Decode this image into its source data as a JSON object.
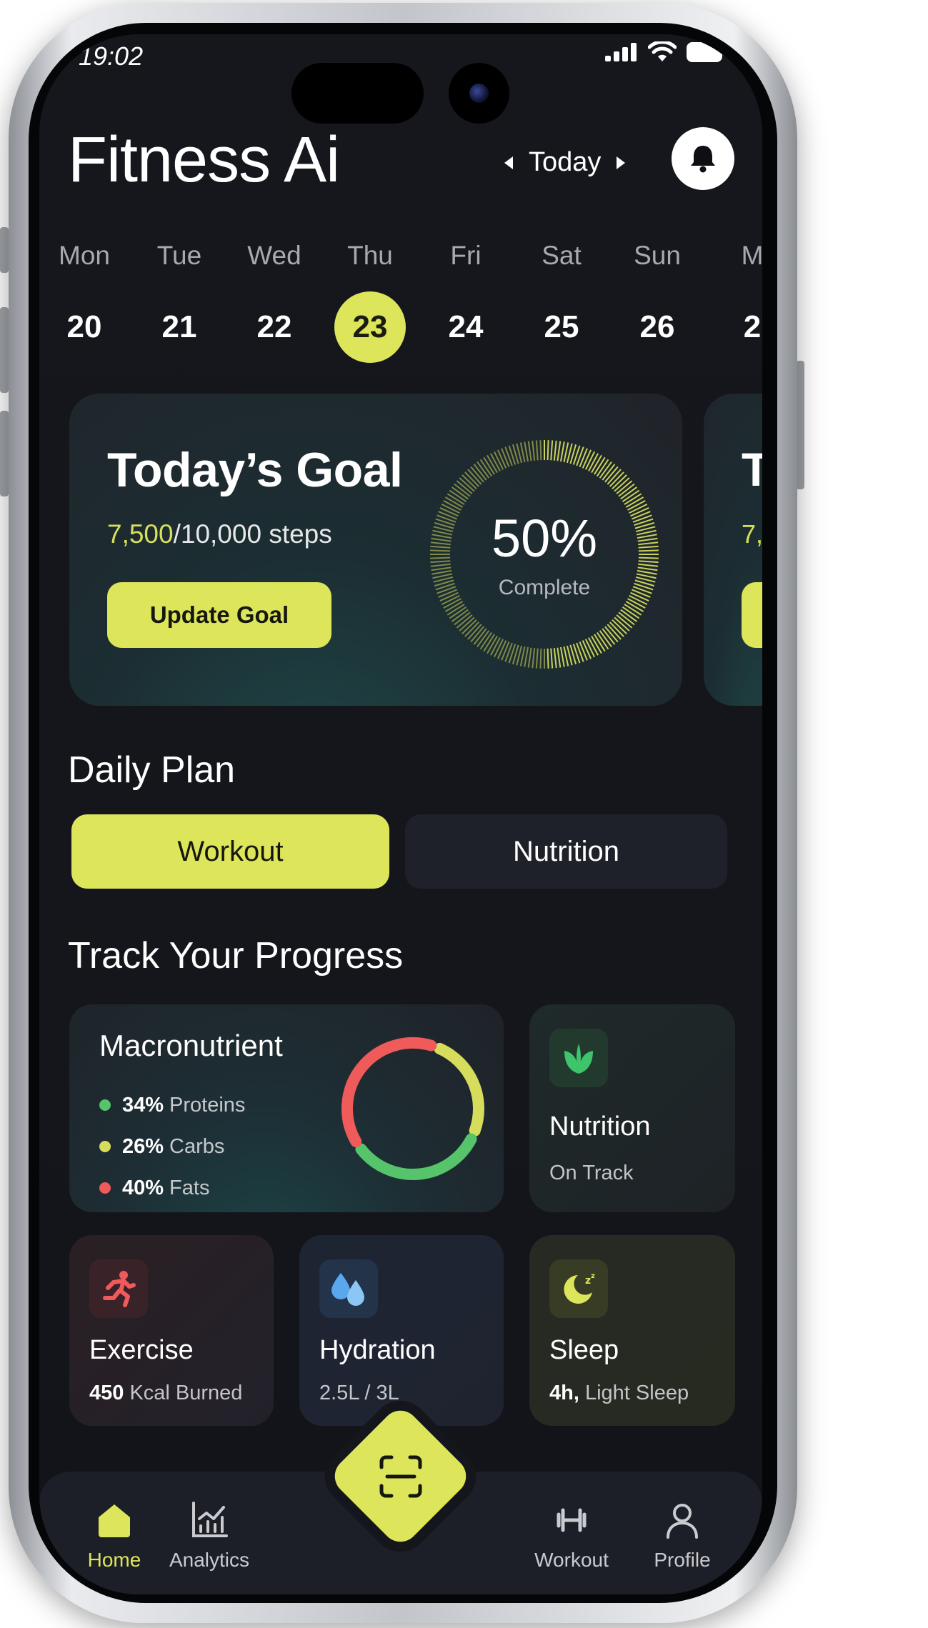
{
  "status_bar": {
    "time": "19:02"
  },
  "header": {
    "title": "Fitness Ai",
    "date_selector": "Today"
  },
  "week": [
    {
      "day": "Mon",
      "date": "20"
    },
    {
      "day": "Tue",
      "date": "21"
    },
    {
      "day": "Wed",
      "date": "22"
    },
    {
      "day": "Thu",
      "date": "23",
      "selected": true
    },
    {
      "day": "Fri",
      "date": "24"
    },
    {
      "day": "Sat",
      "date": "25"
    },
    {
      "day": "Sun",
      "date": "26"
    },
    {
      "day": "M",
      "date": "2"
    }
  ],
  "goal": {
    "title": "Today’s Goal",
    "steps_current": "7,500",
    "steps_rest": "/10,000 steps",
    "button": "Update Goal",
    "percent_label": "50%",
    "percent_value": 0.5,
    "complete_label": "Complete",
    "peek_title": "T",
    "peek_sub": "7,"
  },
  "daily_plan": {
    "title": "Daily Plan",
    "tabs": [
      "Workout",
      "Nutrition"
    ],
    "active_tab": "Workout"
  },
  "progress": {
    "title": "Track Your Progress",
    "macro": {
      "title": "Macronutrient",
      "items": [
        {
          "pct": "34%",
          "label": "Proteins",
          "value": 34,
          "color": "#55c46a"
        },
        {
          "pct": "26%",
          "label": "Carbs",
          "value": 26,
          "color": "#d6dc5c"
        },
        {
          "pct": "40%",
          "label": "Fats",
          "value": 40,
          "color": "#ef5a5a"
        }
      ]
    },
    "nutrition": {
      "title": "Nutrition",
      "sub": "On Track",
      "icon": "leaf-icon"
    },
    "exercise": {
      "title": "Exercise",
      "sub_bold": "450",
      "sub": " Kcal Burned",
      "icon": "running-icon"
    },
    "hydration": {
      "title": "Hydration",
      "sub": "2.5L / 3L",
      "icon": "droplets-icon"
    },
    "sleep": {
      "title": "Sleep",
      "sub_bold": "4h,",
      "sub": " Light Sleep",
      "icon": "moon-icon"
    }
  },
  "bottom_nav": {
    "items": [
      "Home",
      "Analytics",
      "Workout",
      "Profile"
    ],
    "active": "Home"
  },
  "colors": {
    "accent": "#dde55a",
    "background": "#14161b",
    "card": "#1f2228"
  }
}
